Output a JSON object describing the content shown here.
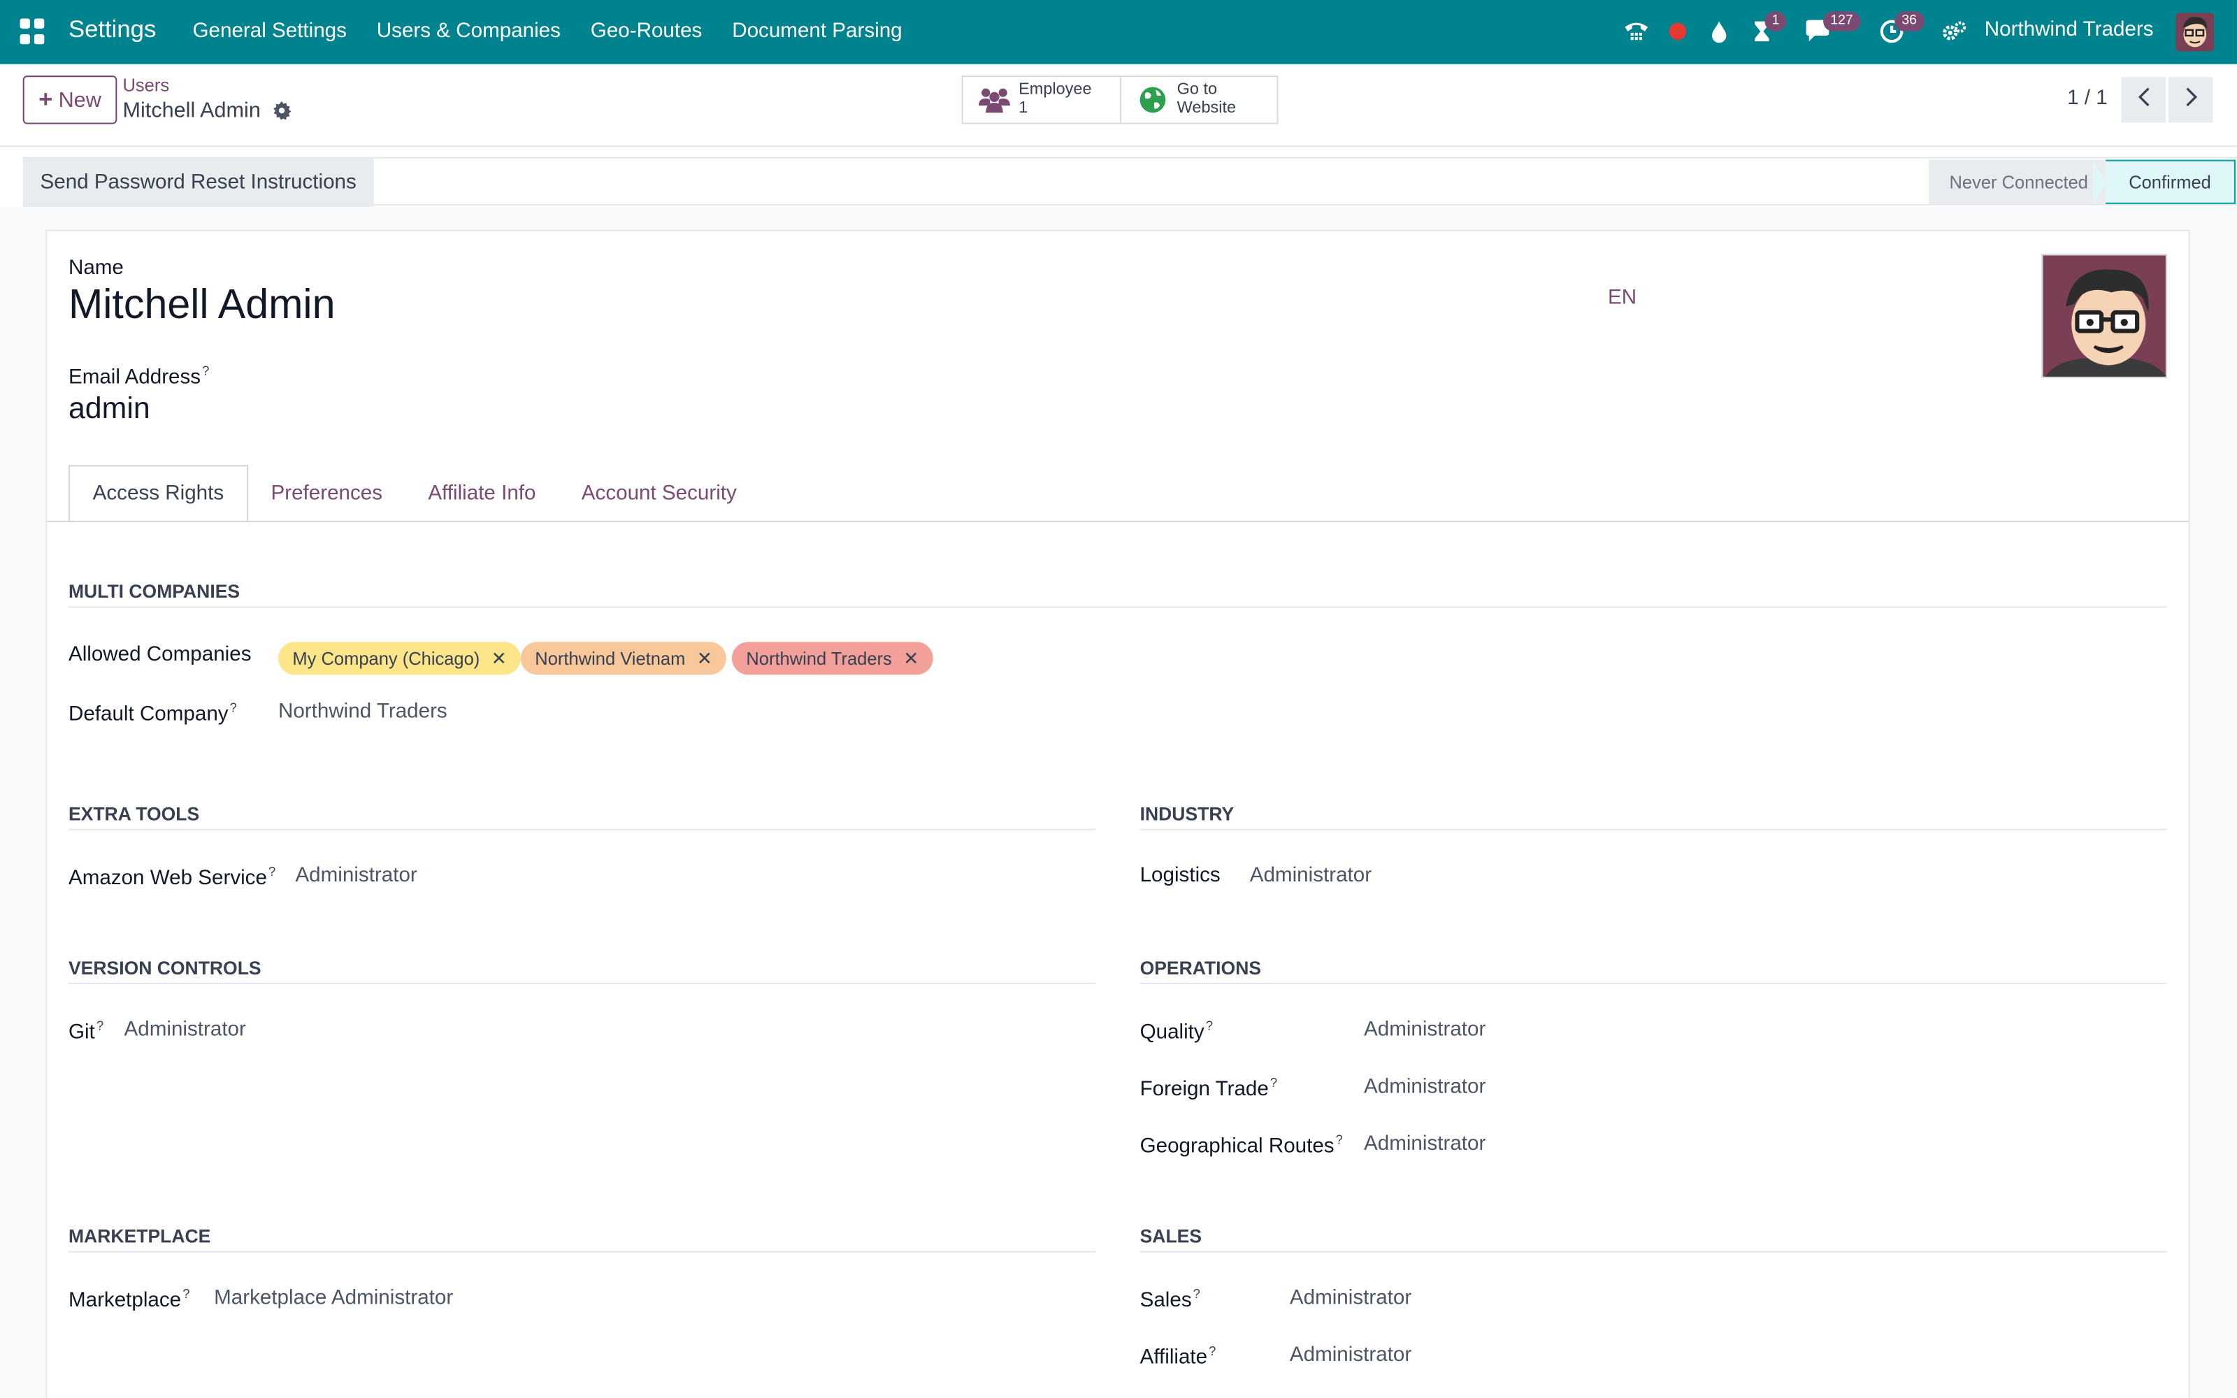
{
  "navbar": {
    "app_title": "Settings",
    "menu": [
      "General Settings",
      "Users & Companies",
      "Geo-Routes",
      "Document Parsing"
    ],
    "badges": {
      "activity": "1",
      "messages": "127",
      "clock": "36"
    },
    "company": "Northwind Traders",
    "colors": {
      "bar": "#00838f",
      "badge": "#7b4a73"
    }
  },
  "control": {
    "new_label": "New",
    "breadcrumb_parent": "Users",
    "breadcrumb_current": "Mitchell Admin",
    "smart": {
      "employee_label": "Employee",
      "employee_count": "1",
      "website_line1": "Go to",
      "website_line2": "Website"
    },
    "pager": "1 / 1"
  },
  "statusbar": {
    "reset_label": "Send Password Reset Instructions",
    "stage_never": "Never Connected",
    "stage_confirmed": "Confirmed"
  },
  "form": {
    "name_label": "Name",
    "name_value": "Mitchell Admin",
    "lang": "EN",
    "email_label": "Email Address",
    "email_value": "admin",
    "help_mark": "?"
  },
  "tabs": [
    "Access Rights",
    "Preferences",
    "Affiliate Info",
    "Account Security"
  ],
  "access": {
    "multi_companies": {
      "title": "MULTI COMPANIES",
      "allowed_label": "Allowed Companies",
      "tags": [
        {
          "label": "My Company (Chicago)",
          "color": "#fde68a"
        },
        {
          "label": "Northwind Vietnam",
          "color": "#f8c89a"
        },
        {
          "label": "Northwind Traders",
          "color": "#f4a09a"
        }
      ],
      "default_label": "Default Company",
      "default_value": "Northwind Traders"
    },
    "extra_tools": {
      "title": "EXTRA TOOLS",
      "label": "Amazon Web Service",
      "value": "Administrator"
    },
    "industry": {
      "title": "INDUSTRY",
      "label": "Logistics",
      "value": "Administrator"
    },
    "version_controls": {
      "title": "VERSION CONTROLS",
      "label": "Git",
      "value": "Administrator"
    },
    "operations": {
      "title": "OPERATIONS",
      "quality_label": "Quality",
      "quality_value": "Administrator",
      "foreign_label": "Foreign Trade",
      "foreign_value": "Administrator",
      "geo_label": "Geographical Routes",
      "geo_value": "Administrator"
    },
    "marketplace": {
      "title": "MARKETPLACE",
      "label": "Marketplace",
      "value": "Marketplace Administrator"
    },
    "sales": {
      "title": "SALES",
      "sales_label": "Sales",
      "sales_value": "Administrator",
      "affiliate_label": "Affiliate",
      "affiliate_value": "Administrator"
    }
  }
}
